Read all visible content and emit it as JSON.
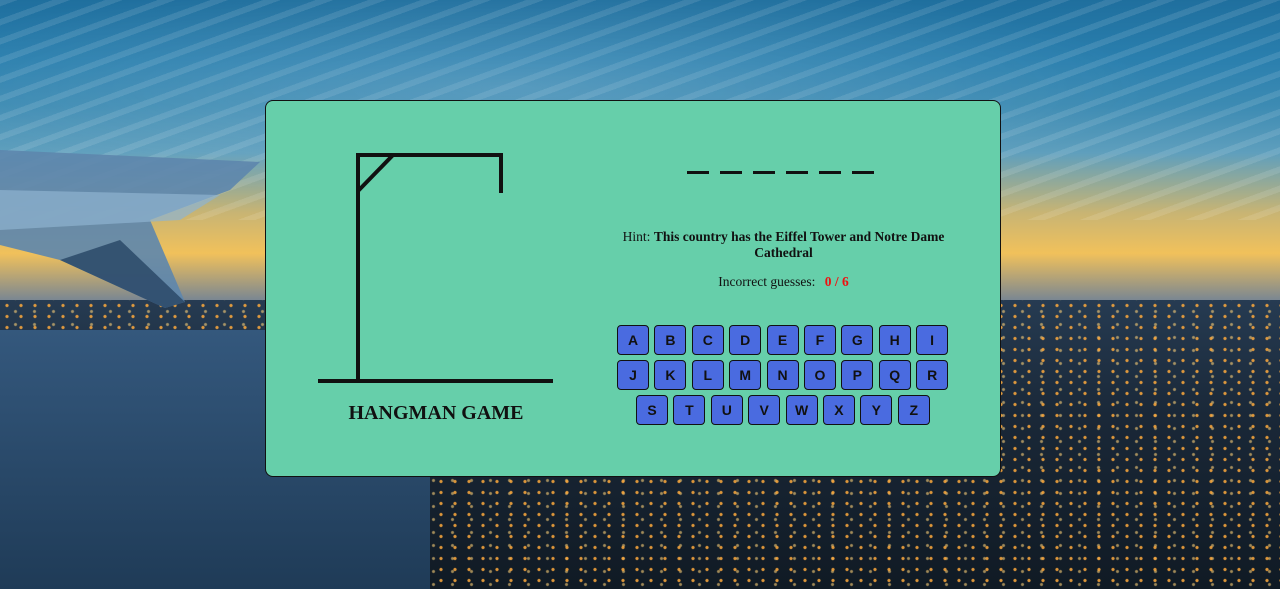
{
  "game": {
    "title": "HANGMAN GAME",
    "word_length": 6,
    "hint_label": "Hint:",
    "hint_text": "This country has the Eiffel Tower and Notre Dame Cathedral",
    "guesses_label": "Incorrect guesses:",
    "guesses_count": "0 / 6"
  },
  "keyboard": {
    "rows": [
      [
        "A",
        "B",
        "C",
        "D",
        "E",
        "F",
        "G",
        "H",
        "I"
      ],
      [
        "J",
        "K",
        "L",
        "M",
        "N",
        "O",
        "P",
        "Q",
        "R"
      ],
      [
        "S",
        "T",
        "U",
        "V",
        "W",
        "X",
        "Y",
        "Z"
      ]
    ]
  },
  "colors": {
    "panel": "#66cfaa",
    "key": "#4a6be0",
    "counter": "#ee1111"
  }
}
